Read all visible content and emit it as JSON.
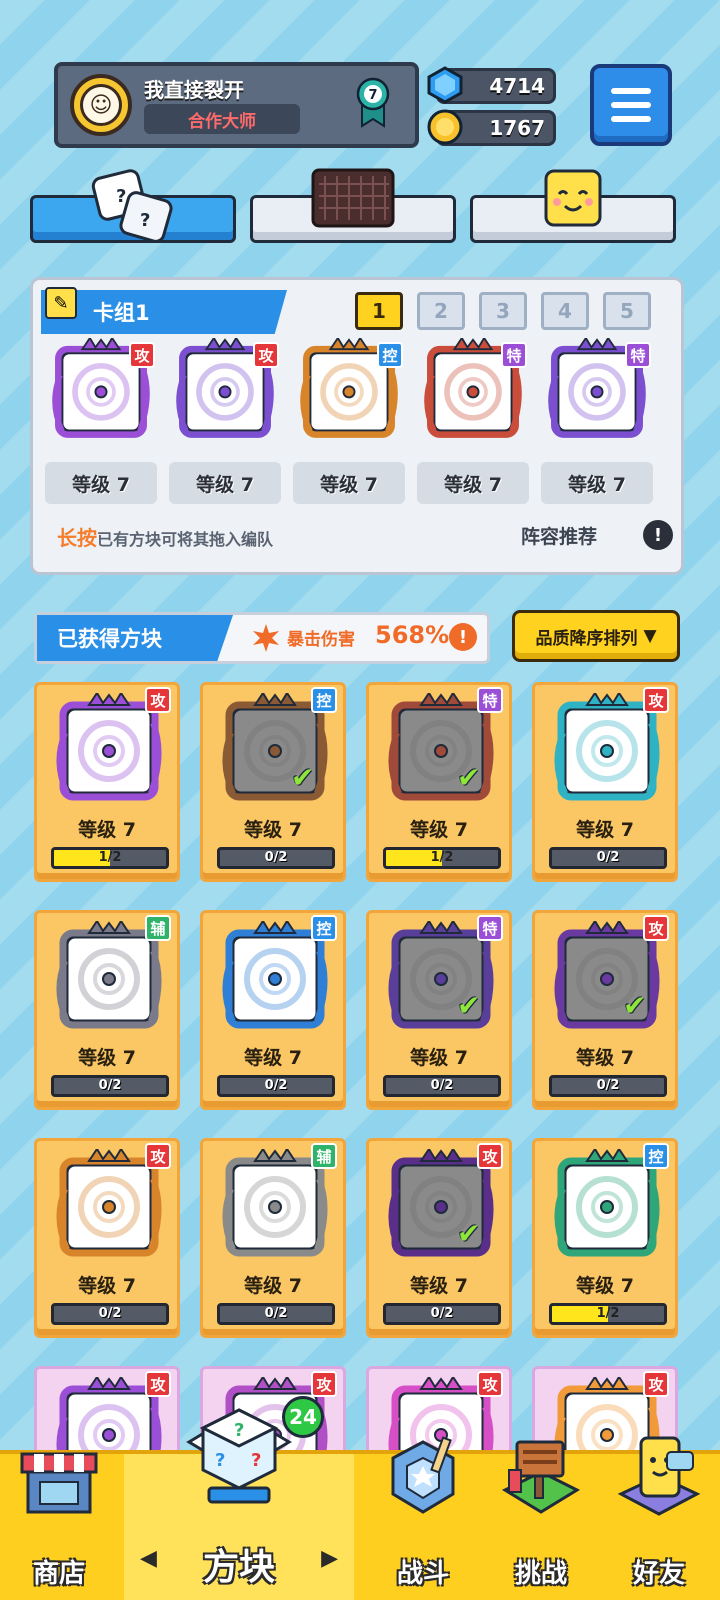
{
  "profile": {
    "name": "我直接裂开",
    "title": "合作大师",
    "rank_level": "7"
  },
  "currency": {
    "gems": "4714",
    "coins": "1767"
  },
  "deck": {
    "title": "卡组1",
    "slots": [
      "1",
      "2",
      "3",
      "4",
      "5"
    ],
    "active_slot": "1",
    "cards": [
      {
        "tag": "攻",
        "level": "等级 7",
        "color": "#9b4fd6"
      },
      {
        "tag": "攻",
        "level": "等级 7",
        "color": "#7c4fd0"
      },
      {
        "tag": "控",
        "level": "等级 7",
        "color": "#d8842b"
      },
      {
        "tag": "特",
        "level": "等级 7",
        "color": "#c94d3a"
      },
      {
        "tag": "特",
        "level": "等级 7",
        "color": "#7c4fd0"
      }
    ],
    "hint_accent": "长按",
    "hint_text": "已有方块可将其拖入编队",
    "lineup_label": "阵容推荐",
    "lineup_info": "!"
  },
  "obtained": {
    "title": "已获得方块",
    "crit_label": "暴击伤害",
    "crit_value": "568%",
    "crit_info": "!",
    "sort_label": "品质降序排列",
    "sort_arrow": "▼"
  },
  "cards": [
    {
      "tag": "攻",
      "level": "等级 7",
      "progress": "1/2",
      "filled": 0.5,
      "color": "#9b4fd6",
      "check": false
    },
    {
      "tag": "控",
      "level": "等级 7",
      "progress": "0/2",
      "filled": 0,
      "color": "#8a5a34",
      "check": true
    },
    {
      "tag": "特",
      "level": "等级 7",
      "progress": "1/2",
      "filled": 0.5,
      "color": "#a04a3a",
      "check": true
    },
    {
      "tag": "攻",
      "level": "等级 7",
      "progress": "0/2",
      "filled": 0,
      "color": "#2fb3c4",
      "check": false
    },
    {
      "tag": "辅",
      "level": "等级 7",
      "progress": "0/2",
      "filled": 0,
      "color": "#7a7a8a",
      "check": false
    },
    {
      "tag": "控",
      "level": "等级 7",
      "progress": "0/2",
      "filled": 0,
      "color": "#2f7fd6",
      "check": false
    },
    {
      "tag": "特",
      "level": "等级 7",
      "progress": "0/2",
      "filled": 0,
      "color": "#5a3f9a",
      "check": true
    },
    {
      "tag": "攻",
      "level": "等级 7",
      "progress": "0/2",
      "filled": 0,
      "color": "#6a3aa0",
      "check": true
    },
    {
      "tag": "攻",
      "level": "等级 7",
      "progress": "0/2",
      "filled": 0,
      "color": "#d8842b",
      "check": false
    },
    {
      "tag": "辅",
      "level": "等级 7",
      "progress": "0/2",
      "filled": 0,
      "color": "#8a8a8a",
      "check": false
    },
    {
      "tag": "攻",
      "level": "等级 7",
      "progress": "0/2",
      "filled": 0,
      "color": "#5a2f8a",
      "check": true
    },
    {
      "tag": "控",
      "level": "等级 7",
      "progress": "1/2",
      "filled": 0.5,
      "color": "#2fa67a",
      "check": false
    },
    {
      "tag": "攻",
      "level": "",
      "progress": "",
      "filled": 0,
      "color": "#9b4fd6",
      "check": false
    },
    {
      "tag": "攻",
      "level": "",
      "progress": "",
      "filled": 0,
      "color": "#b04fc6",
      "check": false
    },
    {
      "tag": "攻",
      "level": "",
      "progress": "",
      "filled": 0,
      "color": "#d64fc6",
      "check": false
    },
    {
      "tag": "攻",
      "level": "",
      "progress": "",
      "filled": 0,
      "color": "#f09a3a",
      "check": false
    }
  ],
  "tag_colors": {
    "攻": "#e5363a",
    "控": "#2a8fe6",
    "特": "#9b4fd6",
    "辅": "#2fb36a"
  },
  "nav": {
    "shop": "商店",
    "blocks": "方块",
    "battle": "战斗",
    "challenge": "挑战",
    "friends": "好友",
    "blocks_badge": "24",
    "left_arrow": "◀",
    "right_arrow": "▶"
  }
}
